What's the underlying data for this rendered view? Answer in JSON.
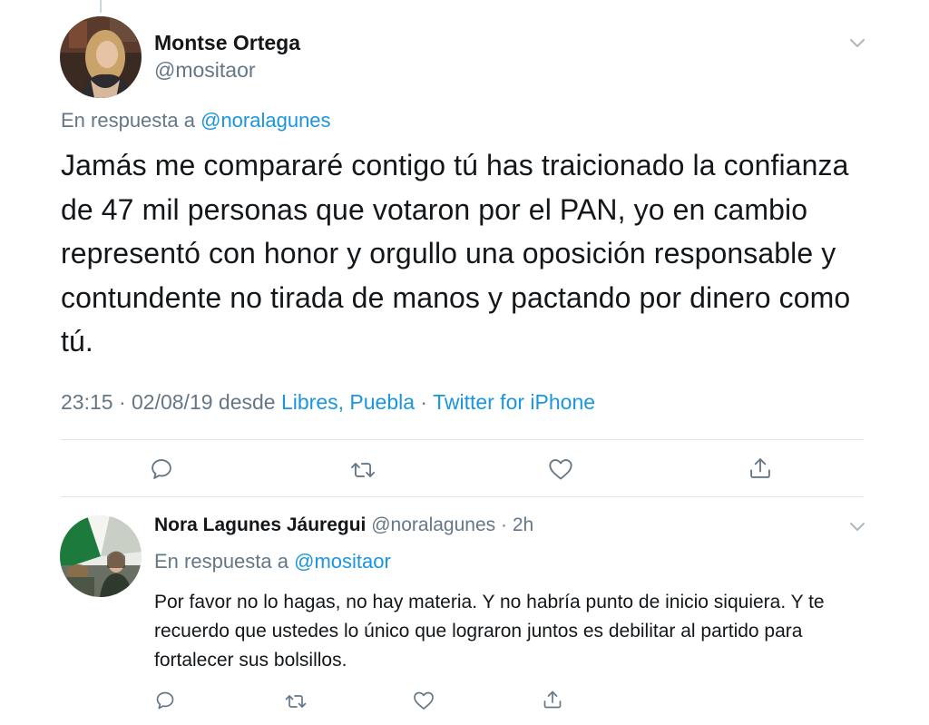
{
  "main_tweet": {
    "author_name": "Montse Ortega",
    "author_handle": "@mositaor",
    "reply_prefix": "En respuesta a",
    "reply_handle": "@noralagunes",
    "text": "Jamás me compararé contigo tú has traicionado la confianza de 47 mil personas que votaron por el PAN, yo en cambio representó con honor y orgullo una oposición responsable y contundente no tirada de manos y pactando por dinero como tú.",
    "meta_time": "23:15 · 02/08/19 desde ",
    "meta_location": "Libres, Puebla",
    "meta_sep": " · ",
    "meta_source": "Twitter for iPhone",
    "actions": [
      "reply-icon",
      "retweet-icon",
      "like-icon",
      "share-icon"
    ]
  },
  "reply_tweet": {
    "author_name": "Nora Lagunes Jáuregui",
    "author_handle": "@noralagunes",
    "time_sep": " · ",
    "time": "2h",
    "reply_prefix": "En respuesta a",
    "reply_handle": "@mositaor",
    "text": "Por favor no lo hagas, no hay materia. Y no habría punto de inicio siquiera. Y  te recuerdo que ustedes lo único que lograron juntos es debilitar al partido para fortalecer sus bolsillos.",
    "actions": [
      "reply-icon",
      "retweet-icon",
      "like-icon",
      "share-icon"
    ]
  },
  "colors": {
    "text": "#14171a",
    "secondary": "#657786",
    "link": "#1b95e0",
    "divider": "#e1e8ed"
  }
}
